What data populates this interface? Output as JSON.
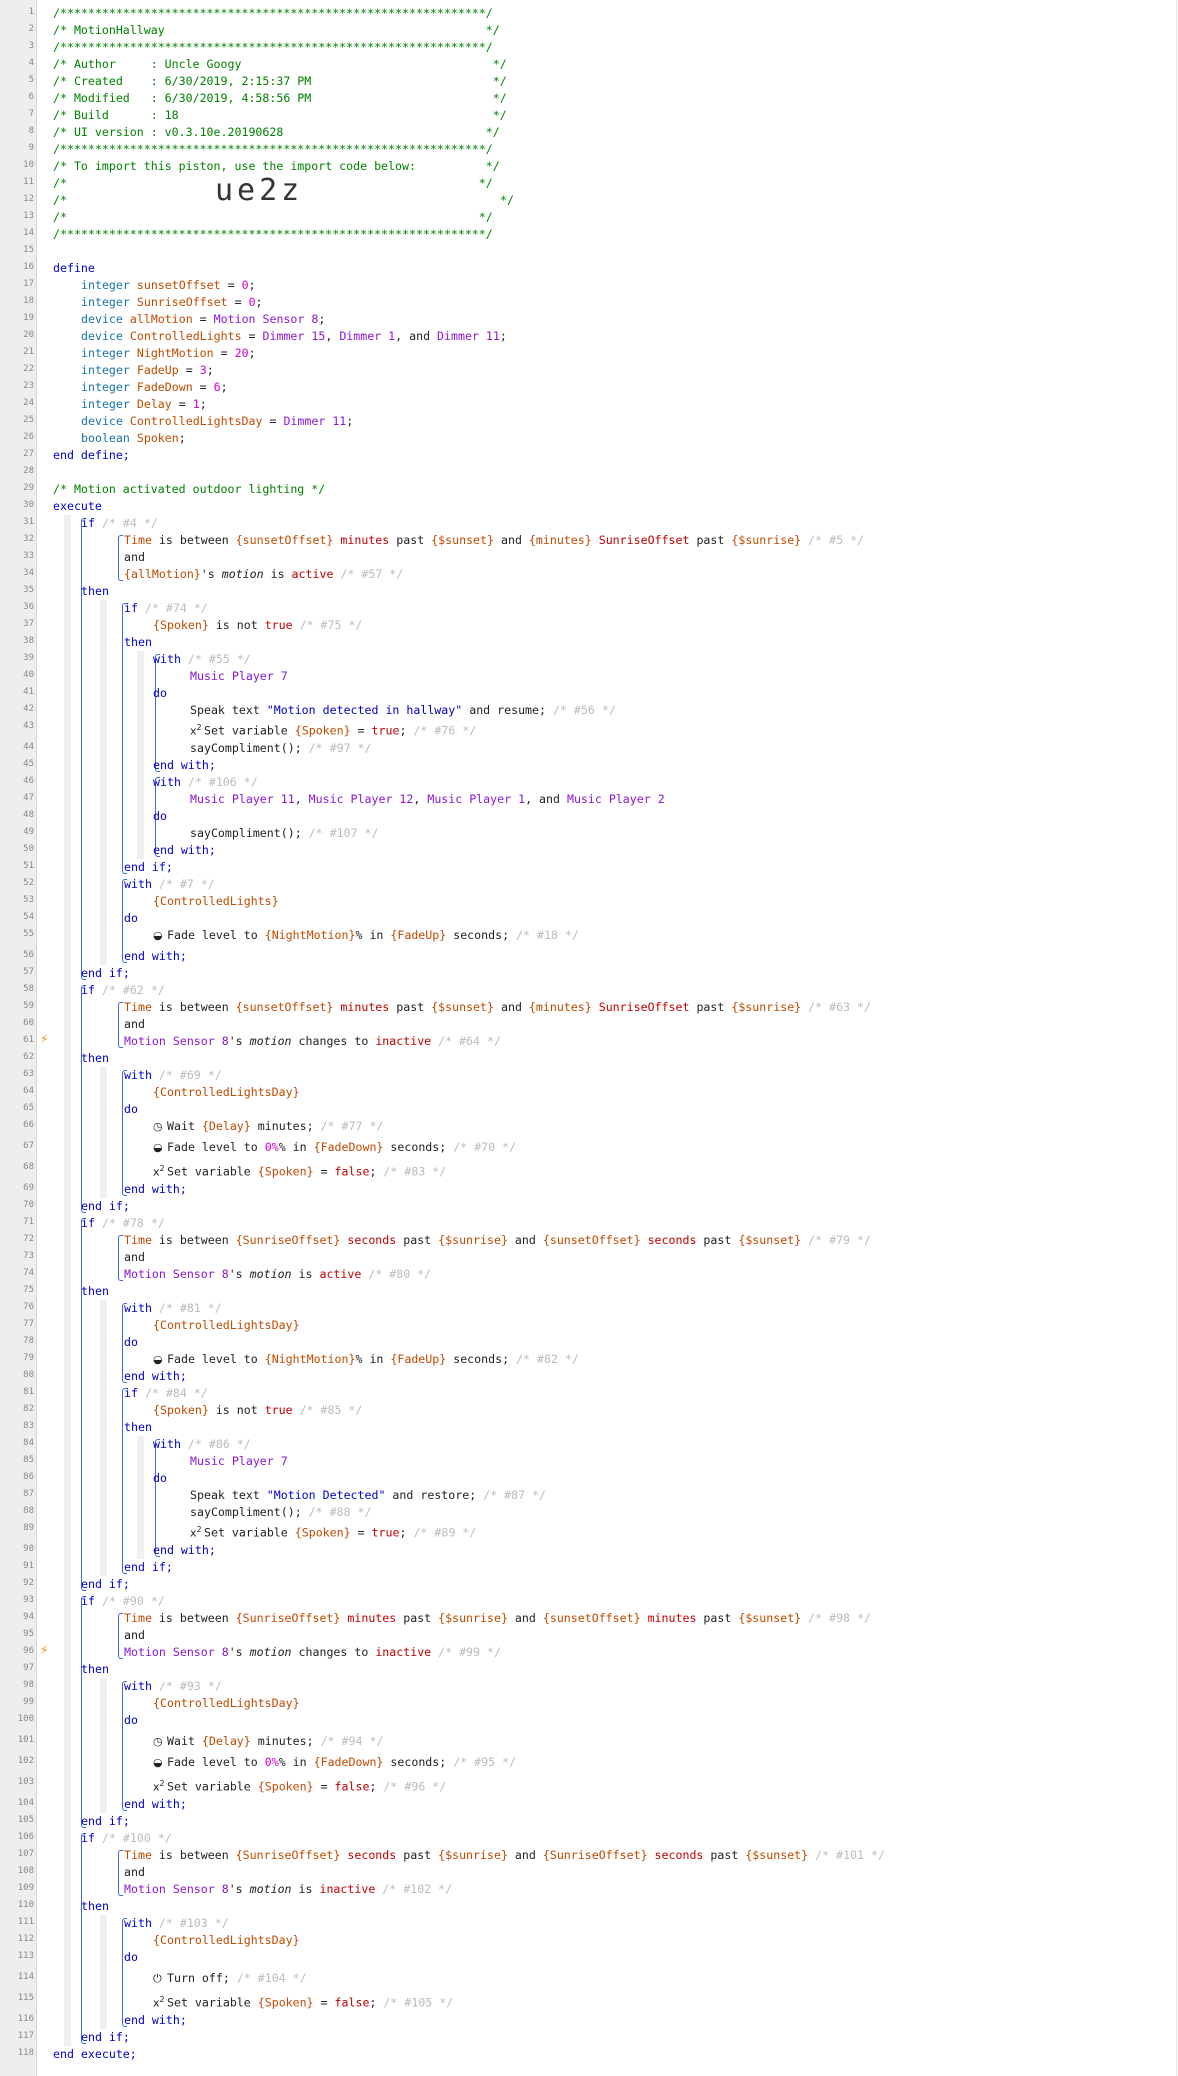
{
  "header": {
    "border": "/*************************************************************/",
    "title": "/* MotionHallway                                              */",
    "author": "/* Author     : Uncle Googy                                    */",
    "created": "/* Created    : 6/30/2019, 2:15:37 PM                          */",
    "modified": "/* Modified   : 6/30/2019, 4:58:56 PM                          */",
    "build": "/* Build      : 18                                             */",
    "ui_version": "/* UI version : v0.3.10e.20190628                             */",
    "import_note": "/* To import this piston, use the import code below:          */",
    "blank": "/*                                                           */",
    "code_prefix": "/*",
    "code_suffix": "*/",
    "import_code": "ue2z"
  },
  "keywords": {
    "define": "define",
    "end_define": "end define;",
    "integer": "integer",
    "device": "device",
    "boolean": "boolean",
    "execute": "execute",
    "end_execute": "end execute;",
    "if": "if",
    "then": "then",
    "end_if": "end if;",
    "with": "with",
    "do": "do",
    "end_with": "end with;",
    "and": "and"
  },
  "colors": {
    "keyword": "#0000cc",
    "variable": "#c04a00",
    "device": "#8a17d8",
    "comment": "#bbbbbb",
    "header": "#008000",
    "operator": "#c00000",
    "bracket": "#3a6bd6",
    "trigger": "#ff8800"
  },
  "icons": {
    "fade": "toggle-icon",
    "wait": "clock-icon",
    "set_variable": "x-squared-icon",
    "turn_off": "power-icon",
    "trigger": "lightning-bolt-icon"
  },
  "line_numbers": [
    "1",
    "2",
    "3",
    "4",
    "5",
    "6",
    "7",
    "8",
    "9",
    "10",
    "11",
    "12",
    "13",
    "14",
    "15",
    "16",
    "17",
    "18",
    "19",
    "20",
    "21",
    "22",
    "23",
    "24",
    "25",
    "26",
    "27",
    "28",
    "29",
    "30",
    "31",
    "32",
    "33",
    "34",
    "35",
    "36",
    "37",
    "38",
    "39",
    "40",
    "41",
    "42",
    "43",
    "44",
    "45",
    "46",
    "47",
    "48",
    "49",
    "50",
    "51",
    "52",
    "53",
    "54",
    "55",
    "56",
    "57",
    "58",
    "59",
    "60",
    "61",
    "62",
    "63",
    "64",
    "65",
    "66",
    "67",
    "68",
    "69",
    "70",
    "71",
    "72",
    "73",
    "74",
    "75",
    "76",
    "77",
    "78",
    "79",
    "80",
    "81",
    "82",
    "83",
    "84",
    "85",
    "86",
    "87",
    "88",
    "89",
    "90",
    "91",
    "92",
    "93",
    "94",
    "95",
    "96",
    "97",
    "98",
    "99",
    "100",
    "101",
    "102",
    "103",
    "104",
    "105",
    "106",
    "107",
    "108",
    "109",
    "110",
    "111",
    "112",
    "113",
    "114",
    "115",
    "116",
    "117",
    "118"
  ],
  "texts": {
    "eq": " = ",
    "semi": ";",
    "comma": ", ",
    "and_sep": ", and ",
    "pct": "%",
    "brace_o": "{",
    "brace_c": "}",
    "zero": "0",
    "one": "1",
    "three": "3",
    "six": "6",
    "twenty": "20",
    "eight": "8",
    "eleven": "11",
    "fifteen": "15",
    "sunsetOffset": "sunsetOffset",
    "SunriseOffset": "SunriseOffset",
    "allMotion": "allMotion",
    "ControlledLights": "ControlledLights",
    "NightMotion": "NightMotion",
    "FadeUp": "FadeUp",
    "FadeDown": "FadeDown",
    "Delay": "Delay",
    "ControlledLightsDay": "ControlledLightsDay",
    "Spoken": "Spoken",
    "motion_sensor_8": "Motion Sensor 8",
    "dimmer_15": "Dimmer 15",
    "dimmer_1": "Dimmer 1",
    "dimmer_11": "Dimmer 11",
    "mp7": "Music Player 7",
    "mp11": "Music Player 11",
    "mp12": "Music Player 12",
    "mp1": "Music Player 1",
    "mp2": "Music Player 2",
    "comment_motion": "/* Motion activated outdoor lighting */",
    "time": "Time",
    "is_between": " is between ",
    "minutes": "minutes",
    "seconds": "seconds",
    "past": " past ",
    "and_w": " and ",
    "sunset": "{$sunset}",
    "sunrise": "{$sunrise}",
    "s_motion": "'s ",
    "motion": "motion",
    "is": " is ",
    "active": "active",
    "inactive": "inactive",
    "changes_to": " changes to ",
    "is_not": " is not ",
    "true": "true",
    "false": "false",
    "speak_text": "Speak text ",
    "q": "\"",
    "speak1": "Motion detected in hallway",
    "and_resume": " and resume;",
    "speak2": "Motion Detected",
    "and_restore": " and restore;",
    "set_variable": "Set variable ",
    "saycompliment": "sayCompliment();",
    "fade_level": "Fade level to ",
    "pct_in": "% in ",
    "seconds_end": " seconds;",
    "wait": "Wait ",
    "minutes_end": " minutes;",
    "turn_off": "Turn off;",
    "zero_pct": "0%",
    "c4": "/* #4 */",
    "c5": "/* #5 */",
    "c57": "/* #57 */",
    "c74": "/* #74 */",
    "c75": "/* #75 */",
    "c55": "/* #55 */",
    "c56": "/* #56 */",
    "c76": "/* #76 */",
    "c97": "/* #97 */",
    "c106": "/* #106 */",
    "c107": "/* #107 */",
    "c7": "/* #7 */",
    "c18": "/* #18 */",
    "c62": "/* #62 */",
    "c63": "/* #63 */",
    "c64": "/* #64 */",
    "c69": "/* #69 */",
    "c77": "/* #77 */",
    "c70": "/* #70 */",
    "c83": "/* #83 */",
    "c78": "/* #78 */",
    "c79": "/* #79 */",
    "c80": "/* #80 */",
    "c81": "/* #81 */",
    "c82": "/* #82 */",
    "c84": "/* #84 */",
    "c85": "/* #85 */",
    "c86": "/* #86 */",
    "c87": "/* #87 */",
    "c88": "/* #88 */",
    "c89": "/* #89 */",
    "c90": "/* #90 */",
    "c98": "/* #98 */",
    "c99": "/* #99 */",
    "c93": "/* #93 */",
    "c94": "/* #94 */",
    "c95": "/* #95 */",
    "c96": "/* #96 */",
    "c100": "/* #100 */",
    "c101": "/* #101 */",
    "c102": "/* #102 */",
    "c103": "/* #103 */",
    "c104": "/* #104 */",
    "c105": "/* #105 */"
  }
}
